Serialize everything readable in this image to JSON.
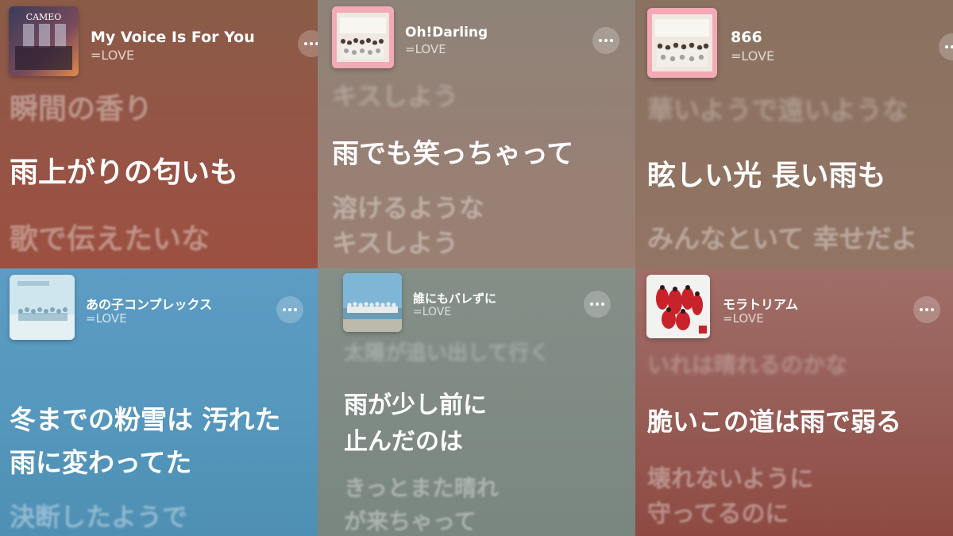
{
  "panels": [
    {
      "title": "My Voice Is For You",
      "artist": "=LOVE",
      "artwork_text": "CAMEO",
      "lyrics": {
        "previous": "瞬間の香り",
        "current": "雨上がりの匂いも",
        "next": "歌で伝えたいな"
      },
      "colors": {
        "top": "#8a5c48",
        "bottom": "#9c5040"
      }
    },
    {
      "title": "Oh!Darling",
      "artist": "=LOVE",
      "lyrics": {
        "previous": "キスしよう",
        "current": "雨でも笑っちゃって",
        "next": [
          "溶けるような",
          "キスしよう"
        ]
      },
      "colors": {
        "top": "#8e8378",
        "bottom": "#9a7f72"
      }
    },
    {
      "title": "866",
      "artist": "=LOVE",
      "lyrics": {
        "previous": "華いようで遠いような",
        "current": "眩しい光 長い雨も",
        "next": "みんなといて 幸せだよ"
      },
      "colors": {
        "top": "#8a7260",
        "bottom": "#927463"
      }
    },
    {
      "title": "あの子コンプレックス",
      "artist": "=LOVE",
      "lyrics": {
        "current": [
          "冬までの粉雪は 汚れた",
          "雨に変わってた"
        ],
        "next": "決断したようで"
      },
      "colors": {
        "top": "#5d9cc4",
        "bottom": "#4e8fb3"
      }
    },
    {
      "title": "誰にもバレずに",
      "artist": "=LOVE",
      "lyrics": {
        "previous": "太陽が追い出して行く",
        "current": [
          "雨が少し前に",
          "止んだのは"
        ],
        "next": [
          "きっとまた晴れ",
          "が来ちゃって"
        ]
      },
      "colors": {
        "top": "#848f88",
        "bottom": "#7a8680"
      }
    },
    {
      "title": "モラトリアム",
      "artist": "=LOVE",
      "lyrics": {
        "previous": "いれは晴れるのかな",
        "current": "脆いこの道は雨で弱る",
        "next": [
          "壊れないように",
          "守ってるのに"
        ]
      },
      "colors": {
        "top": "#a06e68",
        "bottom": "#8e4a42"
      }
    }
  ]
}
